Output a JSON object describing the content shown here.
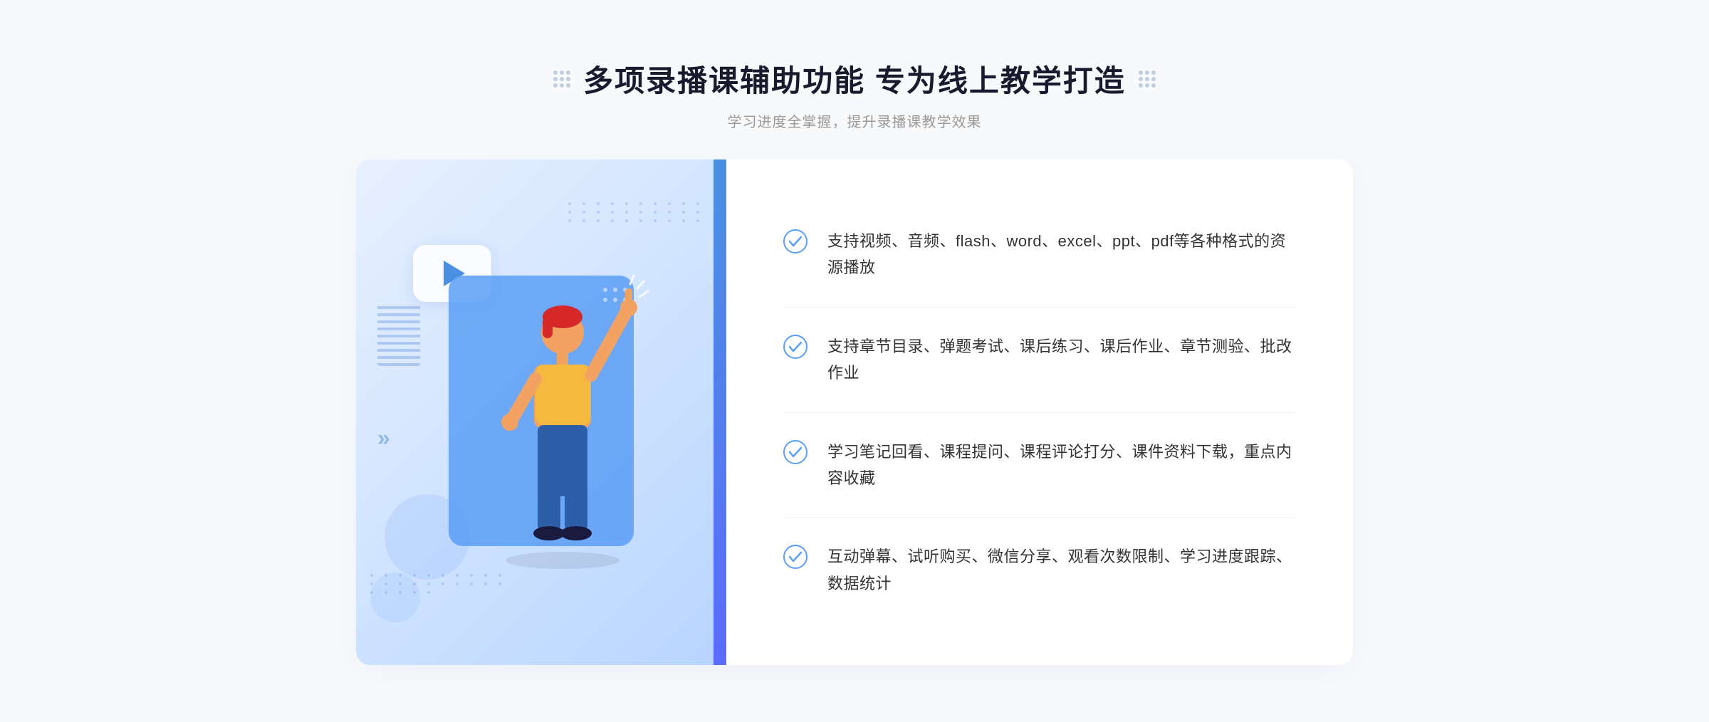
{
  "header": {
    "title": "多项录播课辅助功能 专为线上教学打造",
    "subtitle": "学习进度全掌握，提升录播课教学效果",
    "dots_left": true,
    "dots_right": true
  },
  "features": [
    {
      "id": "feature-1",
      "text": "支持视频、音频、flash、word、excel、ppt、pdf等各种格式的资源播放"
    },
    {
      "id": "feature-2",
      "text": "支持章节目录、弹题考试、课后练习、课后作业、章节测验、批改作业"
    },
    {
      "id": "feature-3",
      "text": "学习笔记回看、课程提问、课程评论打分、课件资料下载，重点内容收藏"
    },
    {
      "id": "feature-4",
      "text": "互动弹幕、试听购买、微信分享、观看次数限制、学习进度跟踪、数据统计"
    }
  ],
  "colors": {
    "accent_blue": "#4a90e2",
    "check_circle": "#5b9ef5",
    "title_color": "#1a1a2e",
    "text_color": "#333333",
    "subtitle_color": "#999999"
  },
  "icons": {
    "check": "check-circle-icon",
    "play": "play-icon",
    "chevron": "chevron-icon"
  }
}
